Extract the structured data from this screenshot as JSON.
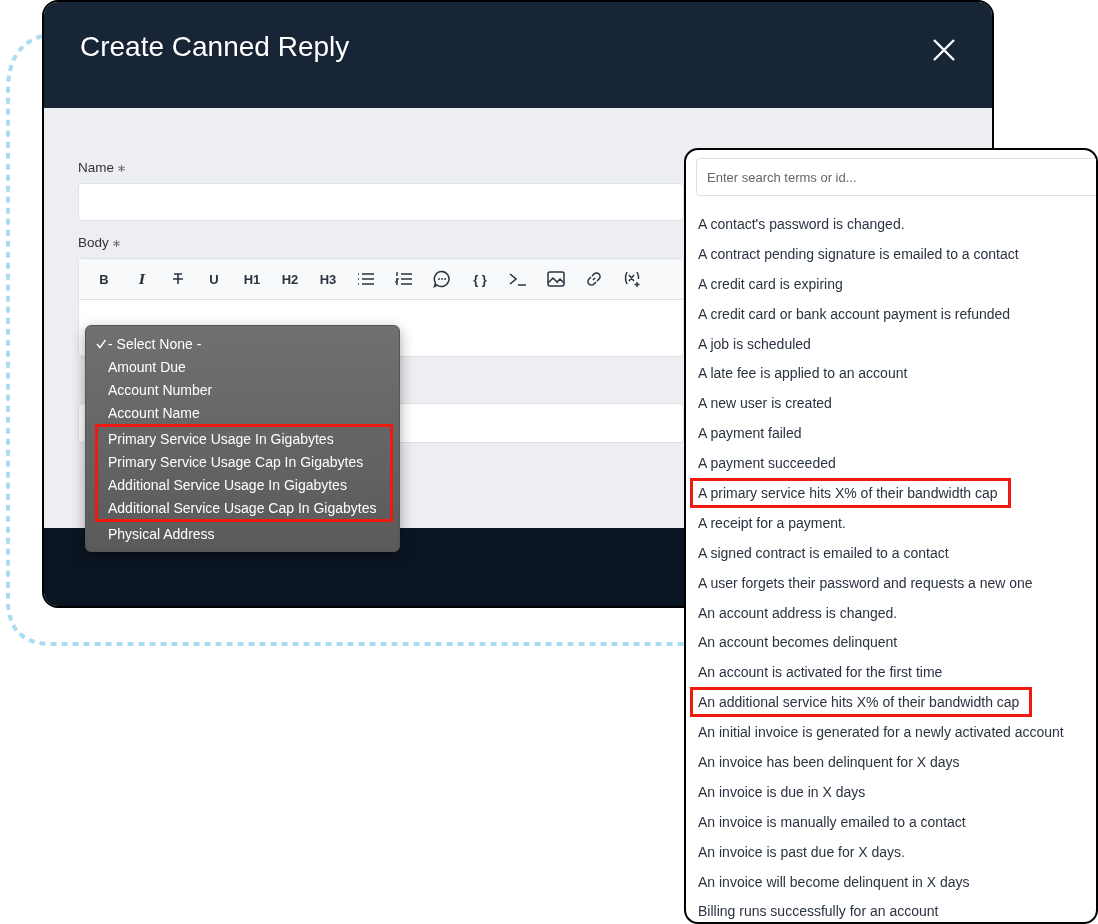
{
  "modal": {
    "title": "Create Canned Reply",
    "fields": [
      {
        "label": "Name",
        "required": true,
        "kind": "input"
      },
      {
        "label": "Body",
        "required": true,
        "kind": "editor"
      }
    ],
    "toolbar": [
      {
        "kind": "text",
        "label": "B"
      },
      {
        "kind": "text",
        "label": "I"
      },
      {
        "kind": "strike"
      },
      {
        "kind": "text",
        "label": "U"
      },
      {
        "kind": "text",
        "label": "H1"
      },
      {
        "kind": "text",
        "label": "H2"
      },
      {
        "kind": "text",
        "label": "H3"
      },
      {
        "kind": "bullets"
      },
      {
        "kind": "numbers"
      },
      {
        "kind": "comment"
      },
      {
        "kind": "text",
        "label": "{ }"
      },
      {
        "kind": "terminal"
      },
      {
        "kind": "image"
      },
      {
        "kind": "link"
      },
      {
        "kind": "variable"
      }
    ]
  },
  "variable_menu": {
    "items": [
      {
        "label": "- Select None -",
        "checked": true,
        "highlighted": false
      },
      {
        "label": "Amount Due",
        "checked": false,
        "highlighted": false
      },
      {
        "label": "Account Number",
        "checked": false,
        "highlighted": false
      },
      {
        "label": "Account Name",
        "checked": false,
        "highlighted": false
      },
      {
        "label": "Primary Service Usage In Gigabytes",
        "checked": false,
        "highlighted": true
      },
      {
        "label": "Primary Service Usage Cap In Gigabytes",
        "checked": false,
        "highlighted": true
      },
      {
        "label": "Additional Service Usage In Gigabytes",
        "checked": false,
        "highlighted": true
      },
      {
        "label": "Additional Service Usage Cap In Gigabytes",
        "checked": false,
        "highlighted": true
      },
      {
        "label": "Physical Address",
        "checked": false,
        "highlighted": false
      }
    ]
  },
  "event_list": {
    "search": {
      "placeholder": "Enter search terms or id..."
    },
    "items": [
      {
        "label": "A contact's password is changed.",
        "highlighted": false
      },
      {
        "label": "A contract pending signature is emailed to a contact",
        "highlighted": false
      },
      {
        "label": "A credit card is expiring",
        "highlighted": false
      },
      {
        "label": "A credit card or bank account payment is refunded",
        "highlighted": false
      },
      {
        "label": "A job is scheduled",
        "highlighted": false
      },
      {
        "label": "A late fee is applied to an account",
        "highlighted": false
      },
      {
        "label": "A new user is created",
        "highlighted": false
      },
      {
        "label": "A payment failed",
        "highlighted": false
      },
      {
        "label": "A payment succeeded",
        "highlighted": false
      },
      {
        "label": "A primary service hits X% of their bandwidth cap",
        "highlighted": true
      },
      {
        "label": "A receipt for a payment.",
        "highlighted": false
      },
      {
        "label": "A signed contract is emailed to a contact",
        "highlighted": false
      },
      {
        "label": "A user forgets their password and requests a new one",
        "highlighted": false
      },
      {
        "label": "An account address is changed.",
        "highlighted": false
      },
      {
        "label": "An account becomes delinquent",
        "highlighted": false
      },
      {
        "label": "An account is activated for the first time",
        "highlighted": false
      },
      {
        "label": "An additional service hits X% of their bandwidth cap",
        "highlighted": true
      },
      {
        "label": "An initial invoice is generated for a newly activated account",
        "highlighted": false
      },
      {
        "label": "An invoice has been delinquent for X days",
        "highlighted": false
      },
      {
        "label": "An invoice is due in X days",
        "highlighted": false
      },
      {
        "label": "An invoice is manually emailed to a contact",
        "highlighted": false
      },
      {
        "label": "An invoice is past due for X days.",
        "highlighted": false
      },
      {
        "label": "An invoice will become delinquent in X days",
        "highlighted": false
      },
      {
        "label": "Billing runs successfully for an account",
        "highlighted": false
      }
    ]
  }
}
